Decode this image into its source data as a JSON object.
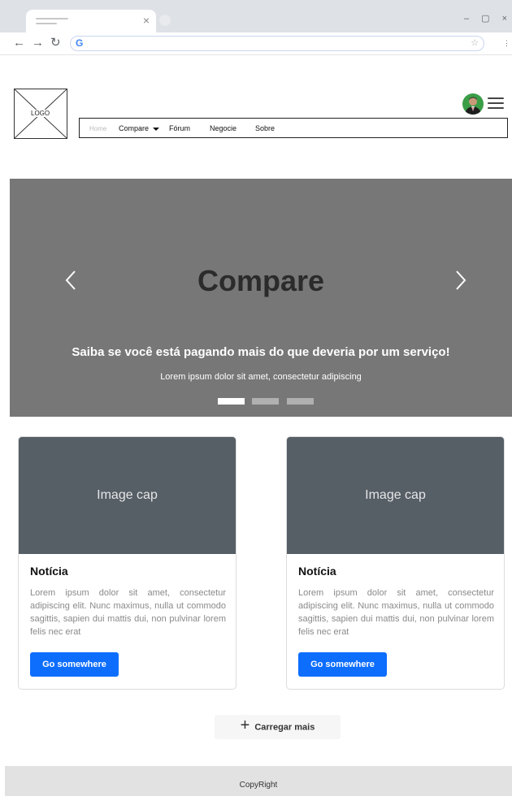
{
  "browser": {
    "tab_close": "×",
    "window_controls": "–  ▢  ×",
    "back_icon": "←",
    "forward_icon": "→",
    "reload_icon": "↻",
    "google_letter": "G",
    "star_icon": "☆",
    "menu_icon": "⋮"
  },
  "header": {
    "logo_text": "LOGO",
    "nav": {
      "home": "Home",
      "compare": "Compare",
      "forum": "Fórum",
      "negocie": "Negocie",
      "sobre": "Sobre"
    }
  },
  "carousel": {
    "title": "Compare",
    "caption": "Saiba se você está pagando mais do que deveria por um serviço!",
    "subtitle": "Lorem ipsum dolor sit amet, consectetur adipiscing",
    "slide_count": 3,
    "active_slide": 1
  },
  "cards": [
    {
      "image_text": "Image cap",
      "title": "Notícia",
      "text": "Lorem ipsum dolor sit amet, consectetur adipiscing elit. Nunc maximus, nulla ut commodo sagittis, sapien dui mattis dui, non pulvinar lorem felis nec erat",
      "button": "Go somewhere"
    },
    {
      "image_text": "Image cap",
      "title": "Notícia",
      "text": "Lorem ipsum dolor sit amet, consectetur adipiscing elit. Nunc maximus, nulla ut commodo sagittis, sapien dui mattis dui, non pulvinar lorem felis nec erat",
      "button": "Go somewhere"
    }
  ],
  "load_more": {
    "icon": "+",
    "label": "Carregar mais"
  },
  "footer": {
    "text": "CopyRight"
  },
  "colors": {
    "primary": "#0d6efd",
    "carousel_bg": "#777777",
    "card_image_bg": "#565e66",
    "footer_bg": "#e2e2e2",
    "avatar_bg": "#3a9e47"
  }
}
